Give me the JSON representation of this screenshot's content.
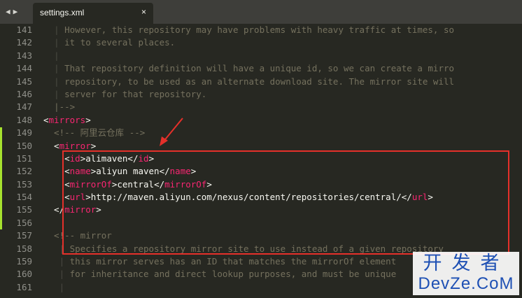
{
  "tabbar": {
    "nav_back_icon": "◀",
    "nav_forward_icon": "▶",
    "tab_title": "settings.xml",
    "tab_close_icon": "×"
  },
  "editor": {
    "lines": [
      {
        "n": "141",
        "spans": [
          {
            "t": "  ",
            "c": "cmt"
          },
          {
            "t": "| ",
            "c": "guide"
          },
          {
            "t": "However, this repository may have problems with heavy traffic at times, so",
            "c": "cmt"
          }
        ]
      },
      {
        "n": "142",
        "spans": [
          {
            "t": "  ",
            "c": "cmt"
          },
          {
            "t": "| ",
            "c": "guide"
          },
          {
            "t": "it to several places.",
            "c": "cmt"
          }
        ]
      },
      {
        "n": "143",
        "spans": [
          {
            "t": "  ",
            "c": "cmt"
          },
          {
            "t": "|",
            "c": "guide"
          }
        ]
      },
      {
        "n": "144",
        "spans": [
          {
            "t": "  ",
            "c": "cmt"
          },
          {
            "t": "| ",
            "c": "guide"
          },
          {
            "t": "That repository definition will have a unique id, so we can create a mirro",
            "c": "cmt"
          }
        ]
      },
      {
        "n": "145",
        "spans": [
          {
            "t": "  ",
            "c": "cmt"
          },
          {
            "t": "| ",
            "c": "guide"
          },
          {
            "t": "repository, to be used as an alternate download site. The mirror site will",
            "c": "cmt"
          }
        ]
      },
      {
        "n": "146",
        "spans": [
          {
            "t": "  ",
            "c": "cmt"
          },
          {
            "t": "| ",
            "c": "guide"
          },
          {
            "t": "server for that repository.",
            "c": "cmt"
          }
        ]
      },
      {
        "n": "147",
        "spans": [
          {
            "t": "  ",
            "c": "cmt"
          },
          {
            "t": "|-->",
            "c": "cmt"
          }
        ]
      },
      {
        "n": "148",
        "spans": [
          {
            "t": "<",
            "c": "txt"
          },
          {
            "t": "mirrors",
            "c": "tag"
          },
          {
            "t": ">",
            "c": "txt"
          }
        ]
      },
      {
        "n": "149",
        "spans": [
          {
            "t": "  <!-- 阿里云仓库 -->",
            "c": "cmt"
          }
        ]
      },
      {
        "n": "150",
        "spans": [
          {
            "t": "  <",
            "c": "txt"
          },
          {
            "t": "mirror",
            "c": "tag"
          },
          {
            "t": ">",
            "c": "txt"
          }
        ]
      },
      {
        "n": "151",
        "spans": [
          {
            "t": "    <",
            "c": "txt"
          },
          {
            "t": "id",
            "c": "tag"
          },
          {
            "t": ">alimaven</",
            "c": "txt"
          },
          {
            "t": "id",
            "c": "tag"
          },
          {
            "t": ">",
            "c": "txt"
          }
        ]
      },
      {
        "n": "152",
        "spans": [
          {
            "t": "    <",
            "c": "txt"
          },
          {
            "t": "name",
            "c": "tag"
          },
          {
            "t": ">aliyun maven</",
            "c": "txt"
          },
          {
            "t": "name",
            "c": "tag"
          },
          {
            "t": ">",
            "c": "txt"
          }
        ]
      },
      {
        "n": "153",
        "spans": [
          {
            "t": "    <",
            "c": "txt"
          },
          {
            "t": "mirrorOf",
            "c": "tag"
          },
          {
            "t": ">central</",
            "c": "txt"
          },
          {
            "t": "mirrorOf",
            "c": "tag"
          },
          {
            "t": ">",
            "c": "txt"
          }
        ]
      },
      {
        "n": "154",
        "spans": [
          {
            "t": "    <",
            "c": "txt"
          },
          {
            "t": "url",
            "c": "tag"
          },
          {
            "t": ">http://maven.aliyun.com/nexus/content/repositories/central/</",
            "c": "txt"
          },
          {
            "t": "url",
            "c": "tag"
          },
          {
            "t": ">",
            "c": "txt"
          }
        ]
      },
      {
        "n": "155",
        "spans": [
          {
            "t": "  </",
            "c": "txt"
          },
          {
            "t": "mirror",
            "c": "tag"
          },
          {
            "t": ">",
            "c": "txt"
          }
        ]
      },
      {
        "n": "156",
        "spans": []
      },
      {
        "n": "157",
        "spans": [
          {
            "t": "  <!-- mirror",
            "c": "cmt"
          }
        ]
      },
      {
        "n": "158",
        "spans": [
          {
            "t": "   ",
            "c": "cmt"
          },
          {
            "t": "| ",
            "c": "guide"
          },
          {
            "t": "Specifies a repository mirror site to use instead of a given repository",
            "c": "cmt"
          }
        ]
      },
      {
        "n": "159",
        "spans": [
          {
            "t": "   ",
            "c": "cmt"
          },
          {
            "t": "| ",
            "c": "guide"
          },
          {
            "t": "this mirror serves has an ID that matches the mirrorOf element",
            "c": "cmt"
          }
        ]
      },
      {
        "n": "160",
        "spans": [
          {
            "t": "   ",
            "c": "cmt"
          },
          {
            "t": "| ",
            "c": "guide"
          },
          {
            "t": "for inheritance and direct lookup purposes, and must be unique",
            "c": "cmt"
          }
        ]
      },
      {
        "n": "161",
        "spans": [
          {
            "t": "   ",
            "c": "cmt"
          },
          {
            "t": "|",
            "c": "guide"
          }
        ]
      }
    ]
  },
  "colors": {
    "background": "#272822",
    "comment": "#75715e",
    "tag": "#f92672",
    "text": "#f8f8f2",
    "line_number": "#90908a",
    "annotation_red": "#e5302a",
    "modified_marker": "#a6e22e"
  },
  "watermark": {
    "cn": "开发者",
    "en": "DevZe.CoM"
  }
}
